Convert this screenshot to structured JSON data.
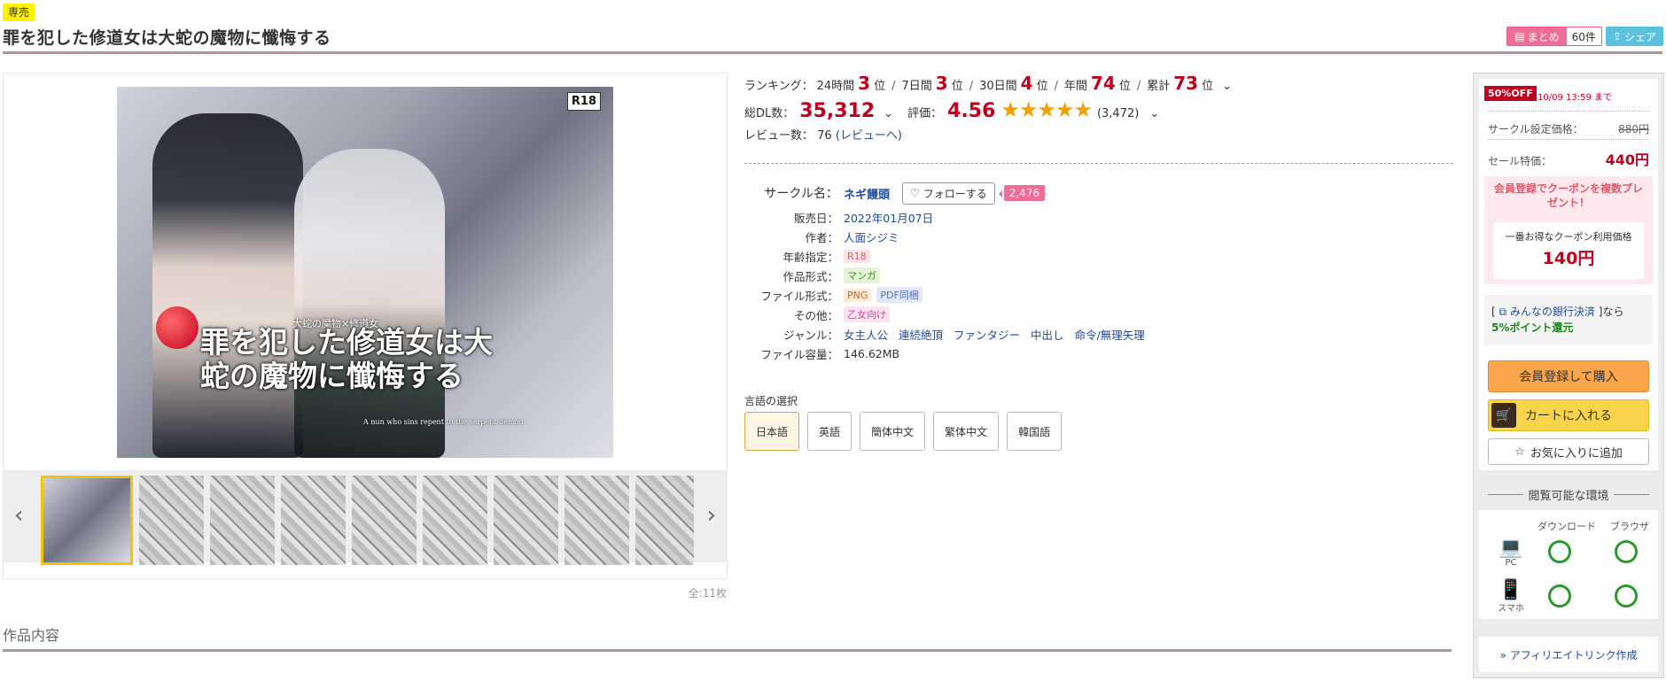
{
  "header": {
    "badge": "専売",
    "title": "罪を犯した修道女は大蛇の魔物に懺悔する",
    "matome_label": "まとめ",
    "matome_count": "60件",
    "share_label": "シェア"
  },
  "gallery": {
    "cover_r18": "R18",
    "cover_title": "罪を犯した修道女は大蛇の魔物に懺悔する",
    "cover_subtitle": "大蛇の魔物×修道女",
    "cover_english": "A nun who sins repent to the serpent demon.",
    "prev_arrow": "‹",
    "next_arrow": "›",
    "count_label": "全:11枚"
  },
  "ranking": {
    "label": "ランキング：",
    "h24_label": "24時間",
    "h24": "3",
    "d7_label": "7日間",
    "d7": "3",
    "d30_label": "30日間",
    "d30": "4",
    "year_label": "年間",
    "year": "74",
    "total_label": "累計",
    "total": "73",
    "unit": "位",
    "sep": "/"
  },
  "stats": {
    "dl_label": "総DL数：",
    "dl_count": "35,312",
    "rating_label": "評価：",
    "rating": "4.56",
    "stars": "★★★★★",
    "rating_count": "(3,472)",
    "review_label": "レビュー数：",
    "review_count": "76",
    "review_link": "(レビューへ)"
  },
  "details": {
    "circle_label": "サークル名：",
    "circle_name": "ネギ饅頭",
    "follow_label": "フォローする",
    "follow_count": "2,476",
    "release_label": "販売日：",
    "release": "2022年01月07日",
    "author_label": "作者：",
    "author": "人面シジミ",
    "age_label": "年齢指定：",
    "age": "R18",
    "form_label": "作品形式：",
    "form": "マンガ",
    "file_label": "ファイル形式：",
    "file_png": "PNG",
    "file_pdf": "PDF同梱",
    "other_label": "その他：",
    "other": "乙女向け",
    "genre_label": "ジャンル：",
    "genres": [
      "女主人公",
      "連続絶頂",
      "ファンタジー",
      "中出し",
      "命令/無理矢理"
    ],
    "size_label": "ファイル容量：",
    "size": "146.62MB"
  },
  "languages": {
    "label": "言語の選択",
    "options": [
      "日本語",
      "英語",
      "簡体中文",
      "繁体中文",
      "韓国語"
    ],
    "selected": "日本語"
  },
  "description": {
    "heading": "作品内容"
  },
  "sidebar": {
    "off_badge": "50%OFF",
    "deadline": "10/09 13:59 まで",
    "circle_price_label": "サークル設定価格：",
    "circle_price": "880円",
    "sale_label": "セール特価：",
    "sale_price": "440円",
    "coupon_title": "会員登録でクーポンを複数プレゼント！",
    "coupon_best_label": "一番お得なクーポン利用価格",
    "coupon_price": "140円",
    "bank_pre": "[",
    "bank_link": "みんなの銀行決済",
    "bank_mid": "]なら",
    "bank_point": "5%ポイント還元",
    "register_button": "会員登録して購入",
    "cart_button": "カートに入れる",
    "fav_button": "お気に入りに追加",
    "env_title": "閲覧可能な環境",
    "env_download": "ダウンロード",
    "env_browser": "ブラウザ",
    "env_pc": "PC",
    "env_phone": "スマホ",
    "affiliate": "» アフィリエイトリンク作成"
  },
  "colors": {
    "accent_red": "#c0001a",
    "star": "#f0a000",
    "link": "#1f4a9c",
    "ok_green": "#2a9a2a"
  }
}
